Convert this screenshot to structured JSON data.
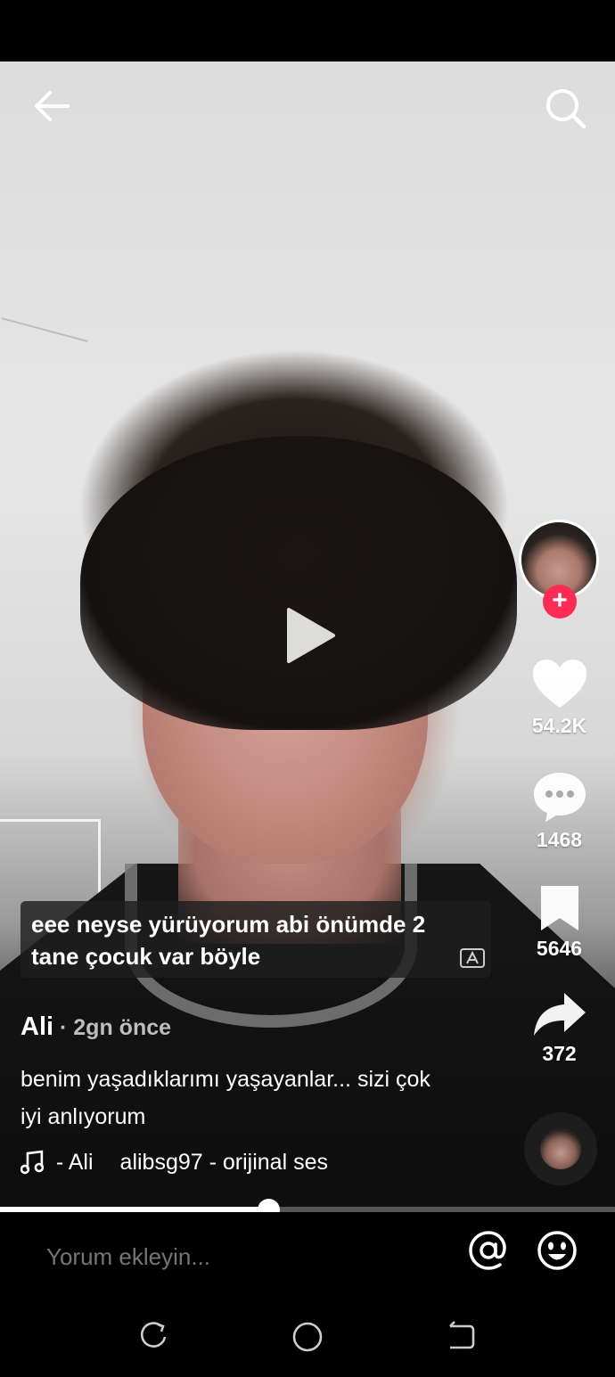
{
  "header": {
    "back_icon": "arrow-left-icon",
    "search_icon": "search-icon"
  },
  "video": {
    "play_icon": "play-icon",
    "subtitle": "eee neyse yürüyorum abi önümde 2 tane çocuk var böyle",
    "translate_icon": "translate-icon"
  },
  "side_actions": {
    "likes": "54.2K",
    "comments": "1468",
    "saves": "5646",
    "shares": "372",
    "follow_symbol": "+"
  },
  "post": {
    "author": "Ali",
    "time": " · 2gn önce",
    "description": "benim yaşadıklarımı yaşayanlar... sizi çok iyi anlıyorum",
    "music_part1": "- Ali",
    "music_part2": "alibsg97 - orijinal ses"
  },
  "progress": {
    "fraction": 0.436
  },
  "comment": {
    "placeholder": "Yorum ekleyin..."
  },
  "colors": {
    "accent": "#fe2c55",
    "background": "#000000"
  }
}
